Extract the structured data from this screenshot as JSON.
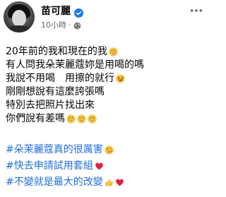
{
  "post": {
    "author_name": "苗可麗",
    "timestamp": "10小時",
    "separator": "·",
    "lines": [
      {
        "text": "20年前的我和現在的我",
        "emoji": [
          "grin-icon"
        ]
      },
      {
        "text": "有人問我朵茉麗蔻妳是用喝的嗎",
        "emoji": []
      },
      {
        "text": "我說不用喝　用擦的就行",
        "emoji": [
          "laugh-tilt-icon"
        ]
      },
      {
        "text": "剛剛想說有這麼誇張嗎",
        "emoji": []
      },
      {
        "text": "特別去把照片找出來",
        "emoji": []
      },
      {
        "text": "你們說有差嗎",
        "emoji": [
          "grin-icon",
          "grin-icon",
          "grin-icon"
        ]
      }
    ],
    "hashtags": [
      {
        "text": "#朵茉麗蔻真的很厲害",
        "emoji": [
          "kiss-icon"
        ]
      },
      {
        "text": "#快去申請試用套組",
        "emoji": [
          "heart-icon"
        ]
      },
      {
        "text": "#不變就是最大的改變",
        "emoji": [
          "thumbs-up-icon",
          "heart-icon"
        ]
      }
    ]
  },
  "colors": {
    "hashtag": "#216fdb",
    "meta": "#65676b",
    "verified": "#1877f2",
    "heart": "#e41e3f",
    "emoji_yellow": "#f7c33b"
  }
}
